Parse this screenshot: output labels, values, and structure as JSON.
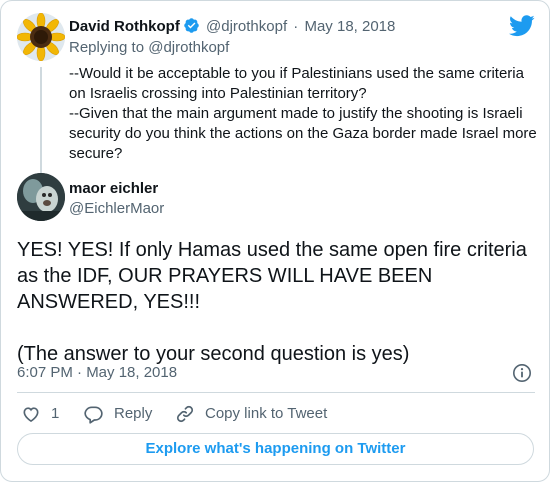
{
  "parent_tweet": {
    "display_name": "David Rothkopf",
    "handle": "@djrothkopf",
    "date": "May 18, 2018",
    "replying_to": "Replying to @djrothkopf",
    "lines": [
      "--Would it be acceptable to you if Palestinians used the same criteria on Israelis crossing into Palestinian territory?",
      "--Given that the main argument made to justify the shooting is Israeli security do you think the actions on the Gaza border made Israel more secure?"
    ],
    "avatar_icon": "sunflower-avatar",
    "verified_icon": "verified-badge-icon"
  },
  "main_tweet": {
    "display_name": "maor eichler",
    "handle": "@EichlerMaor",
    "text_p1": "YES! YES! If only Hamas used the same open fire criteria as the IDF, OUR PRAYERS WILL HAVE BEEN ANSWERED, YES!!!",
    "text_p2": "(The answer to your second question is yes)",
    "timestamp": "6:07 PM · May 18, 2018"
  },
  "actions": {
    "like_count": "1",
    "reply_label": "Reply",
    "copy_link_label": "Copy link to Tweet"
  },
  "explore_label": "Explore what's happening on Twitter",
  "colors": {
    "brand_blue": "#1d9bf0",
    "text": "#0f1419",
    "muted": "#536471",
    "border": "#cfd9de"
  },
  "icons": [
    "twitter-bird-icon",
    "info-icon",
    "heart-icon",
    "reply-icon",
    "link-icon"
  ]
}
